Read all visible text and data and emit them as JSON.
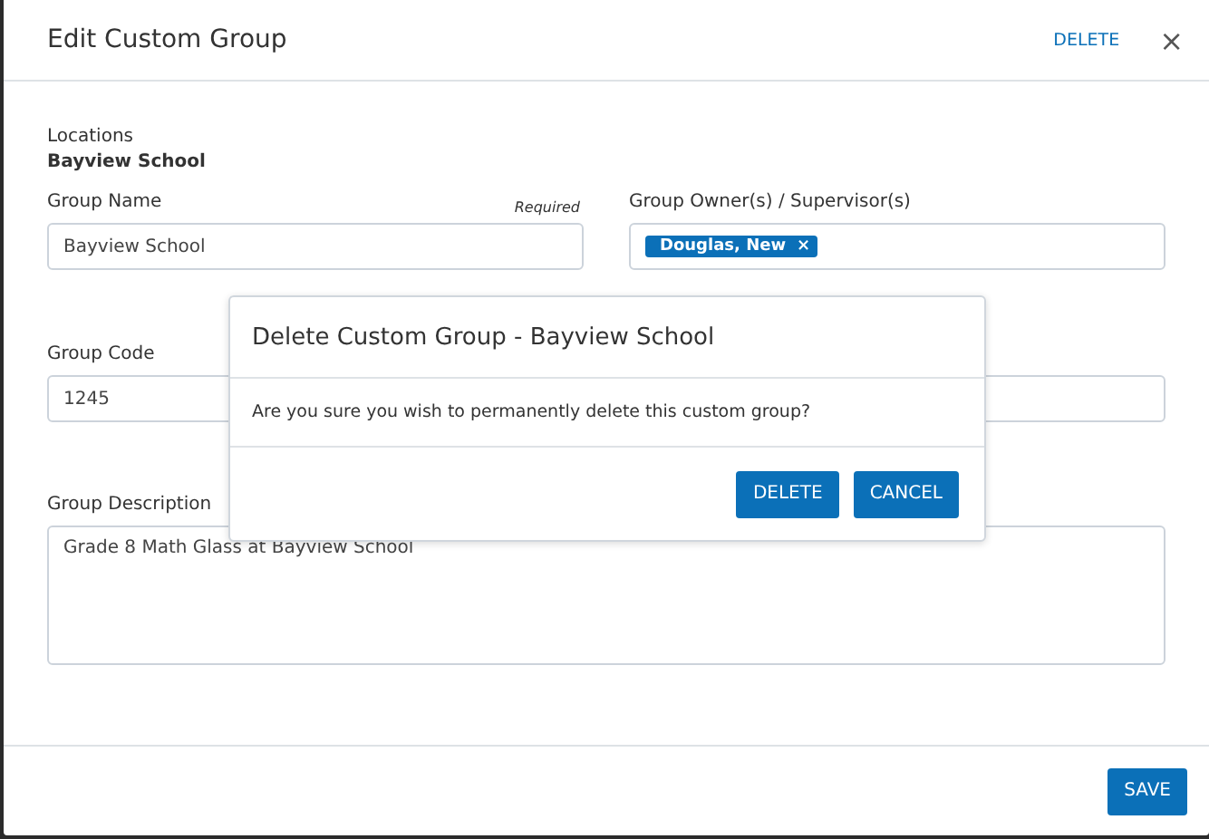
{
  "modal": {
    "title": "Edit Custom Group",
    "delete_link": "DELETE",
    "close": "×"
  },
  "locations": {
    "label": "Locations",
    "value": "Bayview School"
  },
  "group_name": {
    "label": "Group Name",
    "required": "Required",
    "value": "Bayview School"
  },
  "owners": {
    "label": "Group Owner(s) / Supervisor(s)",
    "tags": [
      {
        "label": "Douglas, New",
        "remove": "×"
      }
    ]
  },
  "group_code": {
    "label": "Group Code",
    "value": "1245"
  },
  "description": {
    "label": "Group Description",
    "value": "Grade 8 Math Glass at Bayview School"
  },
  "footer": {
    "save": "SAVE"
  },
  "confirm": {
    "title": "Delete Custom Group - Bayview School",
    "message": "Are you sure you wish to permanently delete this custom group?",
    "buttons": [
      "DELETE",
      "CANCEL"
    ]
  }
}
